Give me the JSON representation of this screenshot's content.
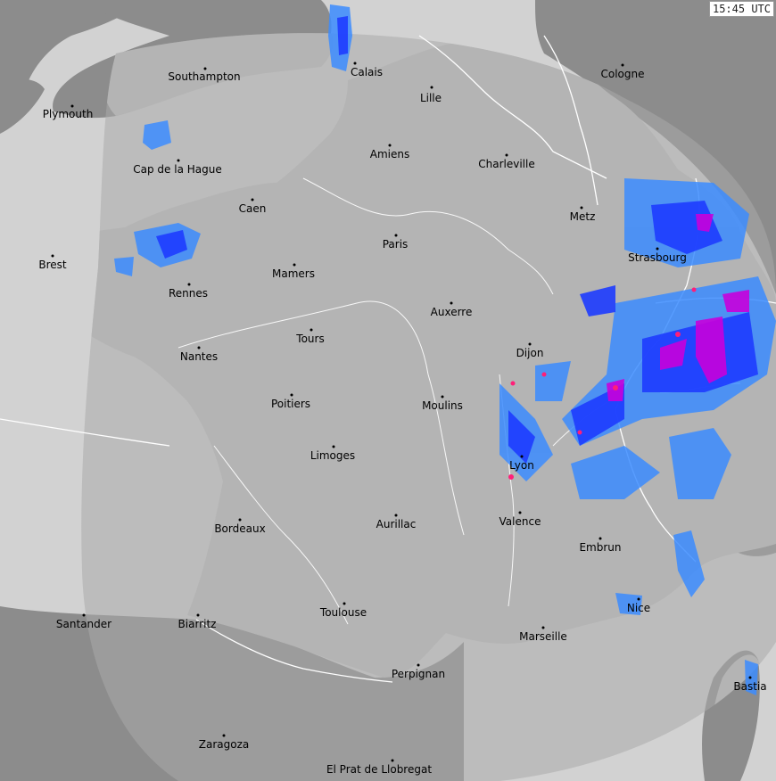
{
  "timestamp": "15:45 UTC",
  "colors": {
    "sea": "#d2d2d2",
    "land_outside": "#8c8c8c",
    "land_inside": "#b4b4b4",
    "radar_coverage": "#a9a9a9",
    "borders": "#ffffff",
    "rain_light": "#3c8cff",
    "rain_moderate": "#1e3cff",
    "rain_heavy": "#c800dc",
    "rain_extreme": "#ff1e78"
  },
  "cities": [
    {
      "id": "southampton",
      "label": "Southampton"
    },
    {
      "id": "calais",
      "label": "Calais"
    },
    {
      "id": "cologne",
      "label": "Cologne"
    },
    {
      "id": "plymouth",
      "label": "Plymouth"
    },
    {
      "id": "lille",
      "label": "Lille"
    },
    {
      "id": "amiens",
      "label": "Amiens"
    },
    {
      "id": "charleville",
      "label": "Charleville"
    },
    {
      "id": "cap-de-la-hague",
      "label": "Cap de la Hague"
    },
    {
      "id": "caen",
      "label": "Caen"
    },
    {
      "id": "metz",
      "label": "Metz"
    },
    {
      "id": "paris",
      "label": "Paris"
    },
    {
      "id": "brest",
      "label": "Brest"
    },
    {
      "id": "strasbourg",
      "label": "Strasbourg"
    },
    {
      "id": "mamers",
      "label": "Mamers"
    },
    {
      "id": "rennes",
      "label": "Rennes"
    },
    {
      "id": "auxerre",
      "label": "Auxerre"
    },
    {
      "id": "tours",
      "label": "Tours"
    },
    {
      "id": "dijon",
      "label": "Dijon"
    },
    {
      "id": "nantes",
      "label": "Nantes"
    },
    {
      "id": "poitiers",
      "label": "Poitiers"
    },
    {
      "id": "moulins",
      "label": "Moulins"
    },
    {
      "id": "limoges",
      "label": "Limoges"
    },
    {
      "id": "lyon",
      "label": "Lyon"
    },
    {
      "id": "valence",
      "label": "Valence"
    },
    {
      "id": "bordeaux",
      "label": "Bordeaux"
    },
    {
      "id": "aurillac",
      "label": "Aurillac"
    },
    {
      "id": "embrun",
      "label": "Embrun"
    },
    {
      "id": "nice",
      "label": "Nice"
    },
    {
      "id": "toulouse",
      "label": "Toulouse"
    },
    {
      "id": "santander",
      "label": "Santander"
    },
    {
      "id": "biarritz",
      "label": "Biarritz"
    },
    {
      "id": "marseille",
      "label": "Marseille"
    },
    {
      "id": "perpignan",
      "label": "Perpignan"
    },
    {
      "id": "bastia",
      "label": "Bastia"
    },
    {
      "id": "zaragoza",
      "label": "Zaragoza"
    },
    {
      "id": "el-prat-de-llobregat",
      "label": "El Prat de Llobregat"
    }
  ]
}
